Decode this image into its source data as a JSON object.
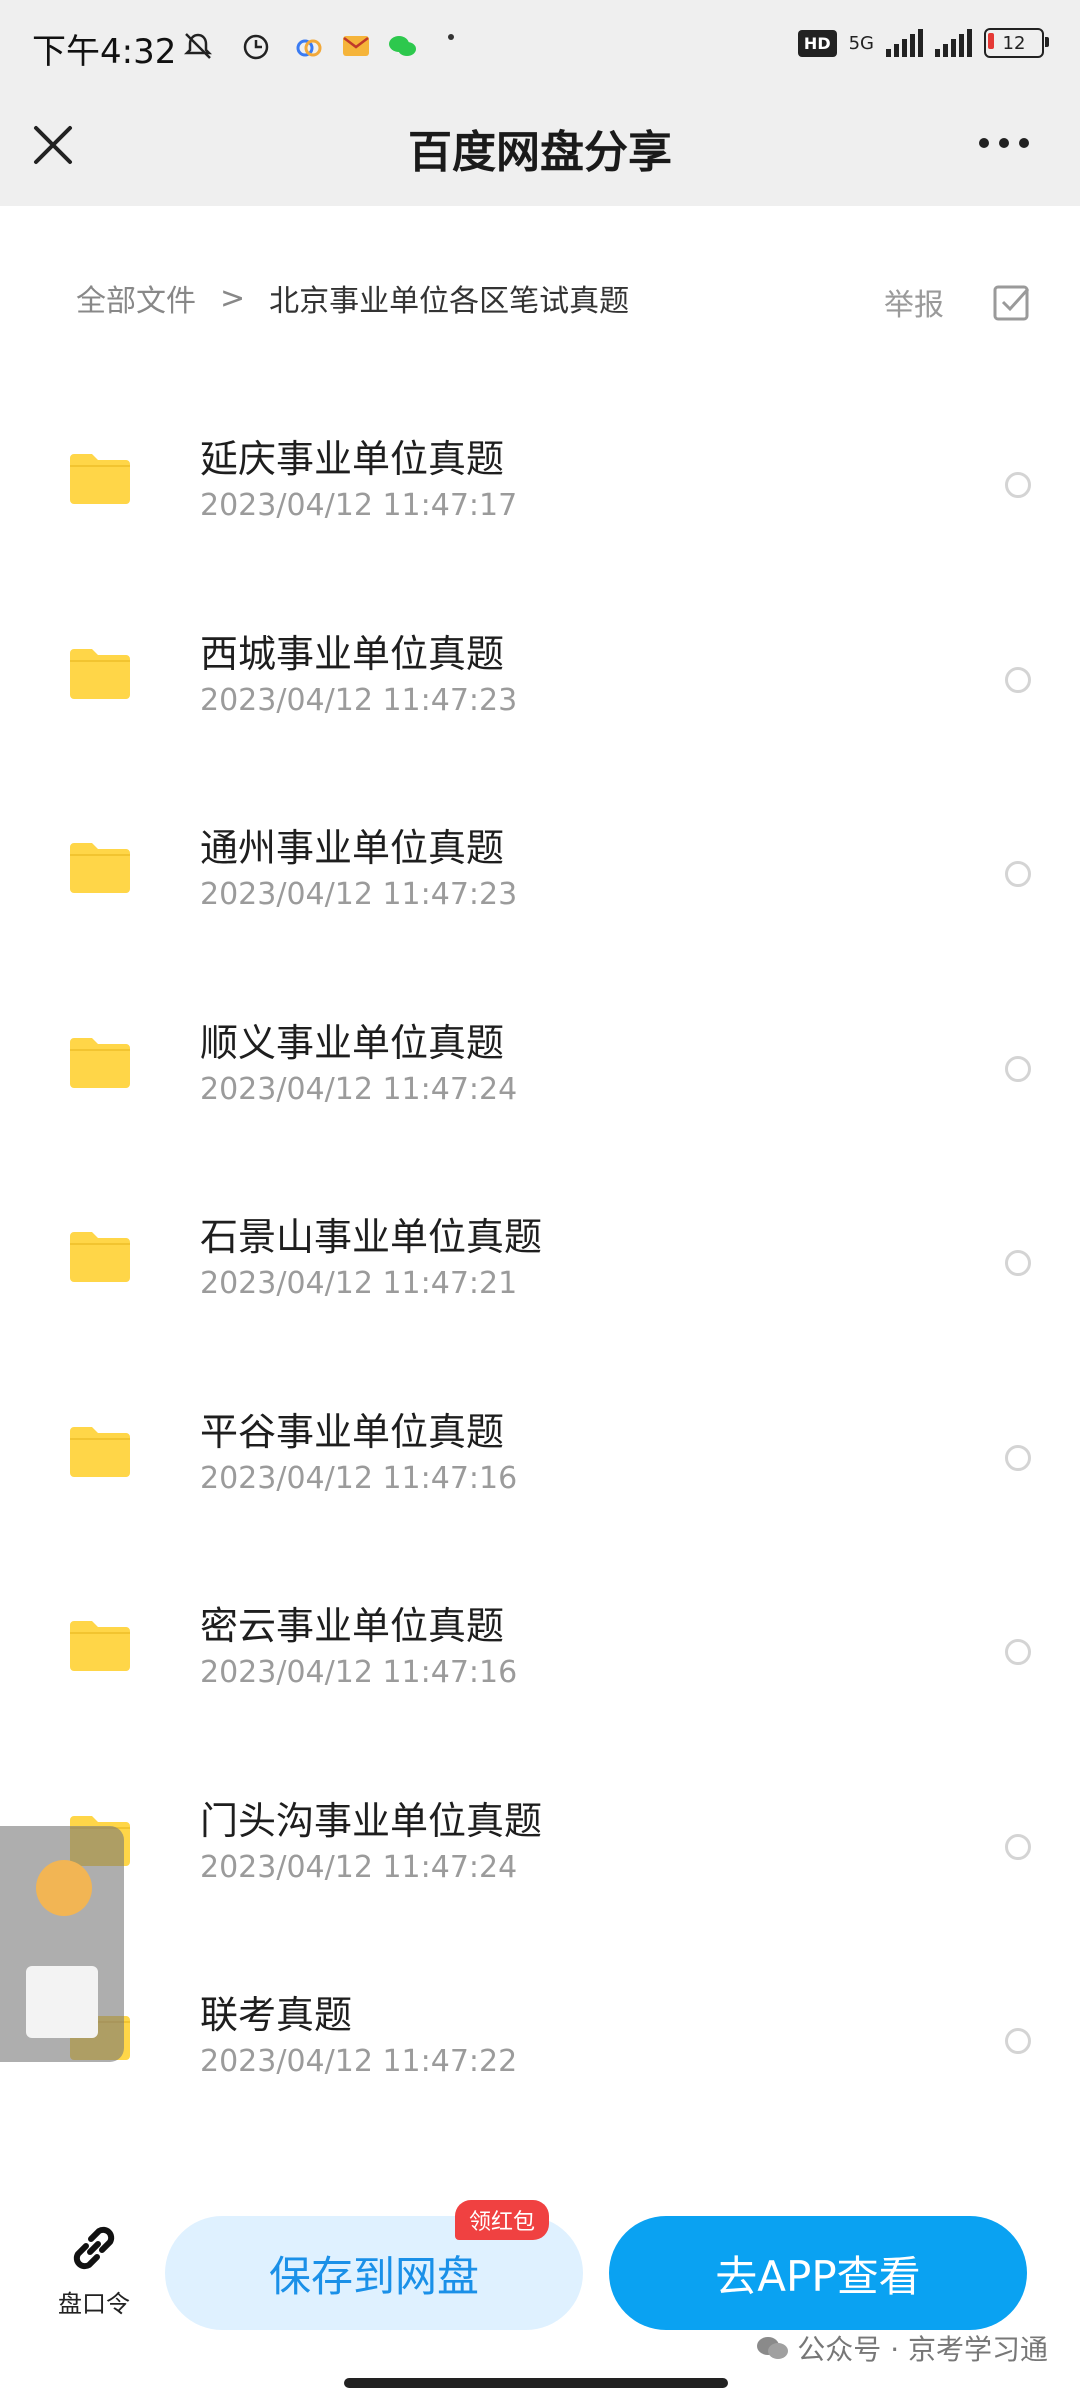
{
  "status_bar": {
    "time": "下午4:32",
    "network_badge": "HD",
    "network_label": "5G",
    "battery": "12",
    "icons": [
      "silent-icon",
      "alarm-icon",
      "baidu-netdisk-icon",
      "mail-icon",
      "wechat-icon",
      "dot-icon"
    ]
  },
  "header": {
    "title": "百度网盘分享",
    "close_icon": "close-icon",
    "more_icon": "more-icon"
  },
  "breadcrumb": {
    "root": "全部文件",
    "separator": ">",
    "current": "北京事业单位各区笔试真题",
    "report": "举报"
  },
  "files": [
    {
      "name": "延庆事业单位真题",
      "time": "2023/04/12 11:47:17"
    },
    {
      "name": "西城事业单位真题",
      "time": "2023/04/12 11:47:23"
    },
    {
      "name": "通州事业单位真题",
      "time": "2023/04/12 11:47:23"
    },
    {
      "name": "顺义事业单位真题",
      "time": "2023/04/12 11:47:24"
    },
    {
      "name": "石景山事业单位真题",
      "time": "2023/04/12 11:47:21"
    },
    {
      "name": "平谷事业单位真题",
      "time": "2023/04/12 11:47:16"
    },
    {
      "name": "密云事业单位真题",
      "time": "2023/04/12 11:47:16"
    },
    {
      "name": "门头沟事业单位真题",
      "time": "2023/04/12 11:47:24"
    },
    {
      "name": "联考真题",
      "time": "2023/04/12 11:47:22"
    }
  ],
  "bottom_bar": {
    "link_label": "盘口令",
    "save_label": "保存到网盘",
    "badge": "领红包",
    "open_app_label": "去APP查看"
  },
  "watermark": "公众号 · 京考学习通",
  "colors": {
    "accent": "#0aa2f2",
    "folder": "#ffd648",
    "badge": "#f04141"
  }
}
